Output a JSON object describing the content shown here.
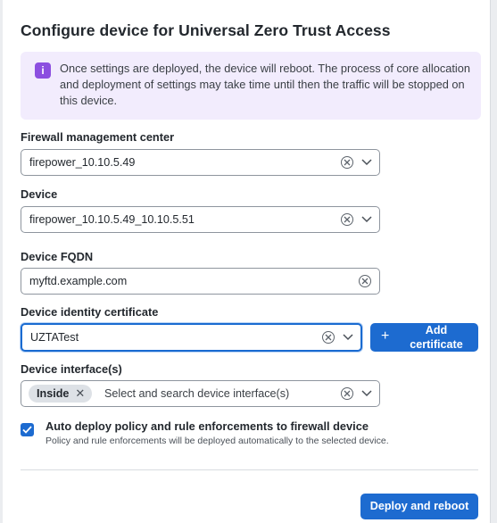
{
  "dialog": {
    "title": "Configure device for Universal Zero Trust Access",
    "info_message": "Once settings are deployed, the device will reboot. The process of core allocation and deployment of settings may take time until then the traffic will be stopped on this device."
  },
  "fields": {
    "fmc": {
      "label": "Firewall management center",
      "value": "firepower_10.10.5.49"
    },
    "device": {
      "label": "Device",
      "value": "firepower_10.10.5.49_10.10.5.51"
    },
    "fqdn": {
      "label": "Device FQDN",
      "value": "myftd.example.com"
    },
    "certificate": {
      "label": "Device identity certificate",
      "value": "UZTATest"
    },
    "interfaces": {
      "label": "Device interface(s)",
      "chip": "Inside",
      "placeholder": "Select and search device interface(s)"
    }
  },
  "buttons": {
    "add_certificate_line1": "Add",
    "add_certificate_line2": "certificate",
    "add_icon": "+",
    "deploy": "Deploy and reboot"
  },
  "auto_deploy": {
    "checked": true,
    "label": "Auto deploy policy and rule enforcements to firewall device",
    "help": "Policy and rule enforcements will be deployed automatically to the selected device."
  },
  "icons": {
    "info": "i",
    "chip_remove": "✕"
  },
  "colors": {
    "primary": "#1d6bd0",
    "info_bg": "#f2ecfd",
    "info_icon": "#8c4fe0"
  }
}
